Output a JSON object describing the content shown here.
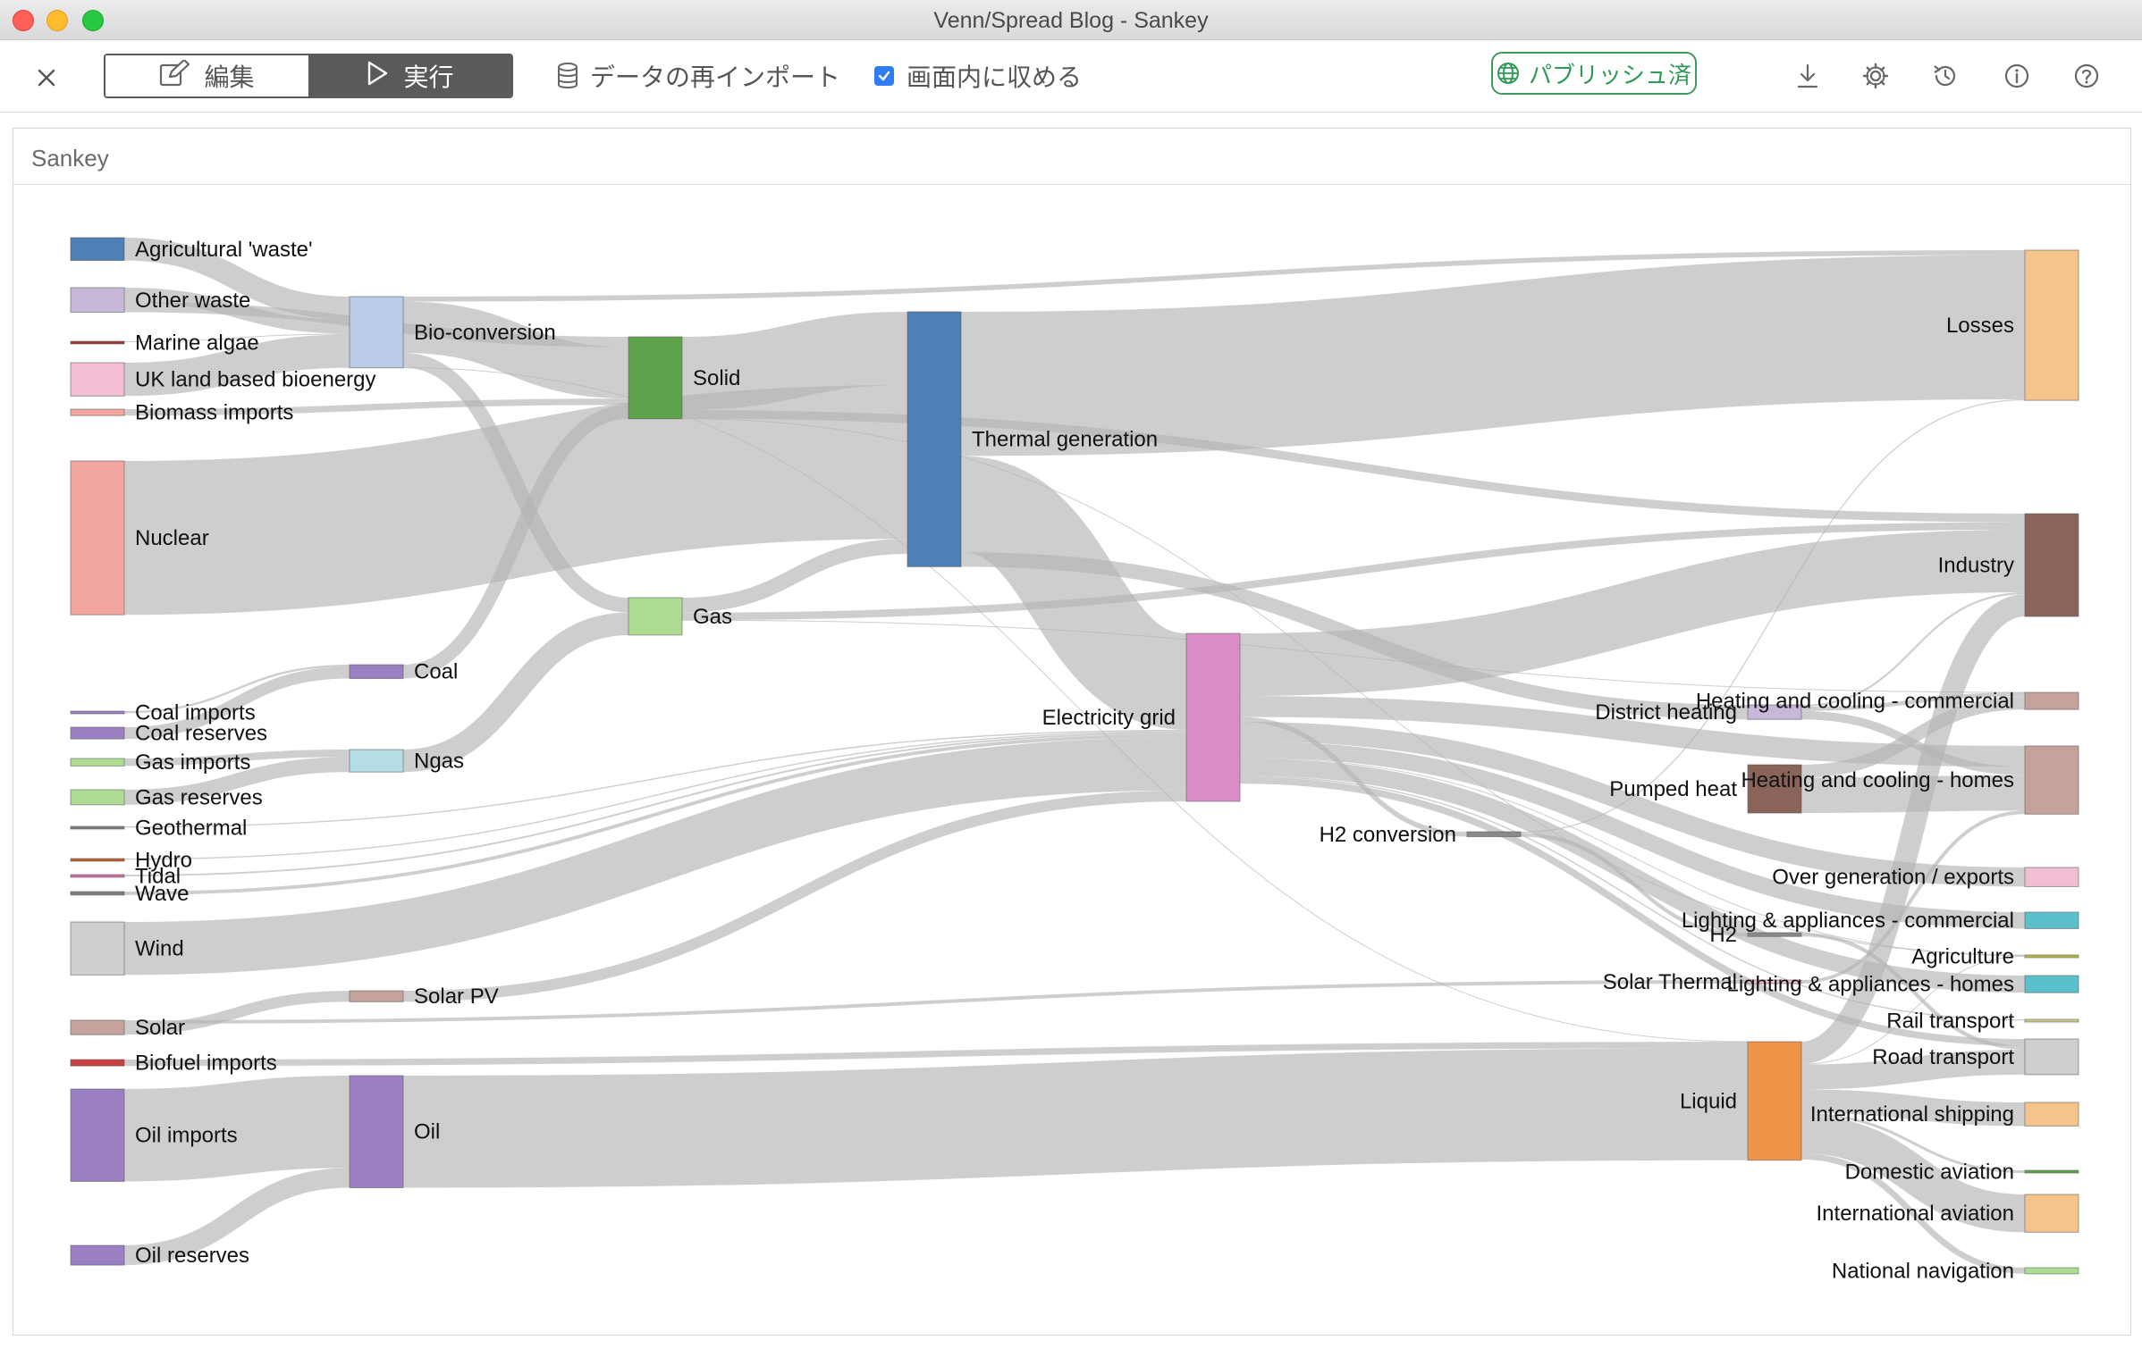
{
  "window": {
    "title": "Venn/Spread Blog - Sankey",
    "controls": [
      "close",
      "minimize",
      "zoom"
    ]
  },
  "toolbar": {
    "close_icon": "close-icon",
    "edit_label": "編集",
    "run_label": "実行",
    "mode_selected": "実行",
    "reimport_label": "データの再インポート",
    "fit_label": "画面内に収める",
    "fit_checked": true,
    "publish_label": "パブリッシュ済",
    "icons": [
      "download-icon",
      "settings-icon",
      "history-icon",
      "info-icon",
      "help-icon"
    ]
  },
  "panel": {
    "title": "Sankey"
  },
  "colors": {
    "accent_dark": "#5a5a5a",
    "checkbox": "#2f7cf6",
    "publish_green": "#2f9a55",
    "link": "#b4b4b4"
  },
  "chart_data": {
    "type": "sankey",
    "nodes": [
      {
        "id": "agri",
        "label": "Agricultural 'waste'",
        "color": "#4e7fb5"
      },
      {
        "id": "otherwaste",
        "label": "Other waste",
        "color": "#c7b8d9"
      },
      {
        "id": "marine",
        "label": "Marine algae",
        "color": "#9c3a3a"
      },
      {
        "id": "ukland",
        "label": "UK land based bioenergy",
        "color": "#f1bed3"
      },
      {
        "id": "biomassimp",
        "label": "Biomass imports",
        "color": "#f2a6a0"
      },
      {
        "id": "nuclear",
        "label": "Nuclear",
        "color": "#f2a6a0"
      },
      {
        "id": "coalimp",
        "label": "Coal imports",
        "color": "#9b7fc3"
      },
      {
        "id": "coalres",
        "label": "Coal reserves",
        "color": "#9b7fc3"
      },
      {
        "id": "gasimp",
        "label": "Gas imports",
        "color": "#addc92"
      },
      {
        "id": "gasres",
        "label": "Gas reserves",
        "color": "#addc92"
      },
      {
        "id": "geothermal",
        "label": "Geothermal",
        "color": "#7f7f7f"
      },
      {
        "id": "hydro",
        "label": "Hydro",
        "color": "#c05c2a"
      },
      {
        "id": "tidal",
        "label": "Tidal",
        "color": "#d16ea6"
      },
      {
        "id": "wave",
        "label": "Wave",
        "color": "#7f7f7f"
      },
      {
        "id": "wind",
        "label": "Wind",
        "color": "#cfcfcf"
      },
      {
        "id": "solar",
        "label": "Solar",
        "color": "#c5a39c"
      },
      {
        "id": "biofuelimp",
        "label": "Biofuel imports",
        "color": "#c94040"
      },
      {
        "id": "oilimp",
        "label": "Oil imports",
        "color": "#9b7fc3"
      },
      {
        "id": "oilres",
        "label": "Oil reserves",
        "color": "#9b7fc3"
      },
      {
        "id": "bioconv",
        "label": "Bio-conversion",
        "color": "#b9cce8"
      },
      {
        "id": "coal",
        "label": "Coal",
        "color": "#9b7fc3"
      },
      {
        "id": "ngas",
        "label": "Ngas",
        "color": "#b5dde7"
      },
      {
        "id": "solarpv",
        "label": "Solar PV",
        "color": "#c5a39c"
      },
      {
        "id": "oil",
        "label": "Oil",
        "color": "#9b7fc3"
      },
      {
        "id": "solid",
        "label": "Solid",
        "color": "#5ea34b"
      },
      {
        "id": "gas",
        "label": "Gas",
        "color": "#addc92"
      },
      {
        "id": "thermal",
        "label": "Thermal generation",
        "color": "#4e7fb5"
      },
      {
        "id": "grid",
        "label": "Electricity grid",
        "color": "#d98cc6"
      },
      {
        "id": "h2conv",
        "label": "H2 conversion",
        "color": "#8a8a8a"
      },
      {
        "id": "districtheat",
        "label": "District heating",
        "color": "#c7b8d9"
      },
      {
        "id": "pumpedheat",
        "label": "Pumped heat",
        "color": "#8b6459"
      },
      {
        "id": "h2",
        "label": "H2",
        "color": "#8a8a8a"
      },
      {
        "id": "solarthermal",
        "label": "Solar Thermal",
        "color": "#f1bed3"
      },
      {
        "id": "liquid",
        "label": "Liquid",
        "color": "#f0944a"
      },
      {
        "id": "losses",
        "label": "Losses",
        "color": "#f5c48c"
      },
      {
        "id": "industry",
        "label": "Industry",
        "color": "#8b6459"
      },
      {
        "id": "hccomm",
        "label": "Heating and cooling - commercial",
        "color": "#c5a39c"
      },
      {
        "id": "hchomes",
        "label": "Heating and cooling - homes",
        "color": "#c5a39c"
      },
      {
        "id": "overgen",
        "label": "Over generation / exports",
        "color": "#f1bed3"
      },
      {
        "id": "lacomm",
        "label": "Lighting & appliances - commercial",
        "color": "#5bbfcc"
      },
      {
        "id": "agriculture",
        "label": "Agriculture",
        "color": "#b8b845"
      },
      {
        "id": "lahomes",
        "label": "Lighting & appliances - homes",
        "color": "#5bbfcc"
      },
      {
        "id": "rail",
        "label": "Rail transport",
        "color": "#c9c98a"
      },
      {
        "id": "road",
        "label": "Road transport",
        "color": "#cfcfcf"
      },
      {
        "id": "intship",
        "label": "International shipping",
        "color": "#f5c48c"
      },
      {
        "id": "domav",
        "label": "Domestic aviation",
        "color": "#5ea34b"
      },
      {
        "id": "intav",
        "label": "International aviation",
        "color": "#f5c48c"
      },
      {
        "id": "natnav",
        "label": "National navigation",
        "color": "#addc92"
      }
    ],
    "links": [
      {
        "source": "agri",
        "target": "bioconv",
        "value": 124.7
      },
      {
        "source": "bioconv",
        "target": "liquid",
        "value": 0.6
      },
      {
        "source": "bioconv",
        "target": "losses",
        "value": 26.9
      },
      {
        "source": "bioconv",
        "target": "solid",
        "value": 280.3
      },
      {
        "source": "bioconv",
        "target": "gas",
        "value": 81.1
      },
      {
        "source": "biofuelimp",
        "target": "liquid",
        "value": 35
      },
      {
        "source": "biomassimp",
        "target": "solid",
        "value": 35
      },
      {
        "source": "coalimp",
        "target": "coal",
        "value": 11.6
      },
      {
        "source": "coalres",
        "target": "coal",
        "value": 63.9
      },
      {
        "source": "coal",
        "target": "solid",
        "value": 75.6
      },
      {
        "source": "districtheat",
        "target": "industry",
        "value": 10.6
      },
      {
        "source": "districtheat",
        "target": "hccomm",
        "value": 22.5
      },
      {
        "source": "districtheat",
        "target": "hchomes",
        "value": 46.2
      },
      {
        "source": "grid",
        "target": "overgen",
        "value": 104.5
      },
      {
        "source": "grid",
        "target": "hchomes",
        "value": 113.7
      },
      {
        "source": "grid",
        "target": "h2conv",
        "value": 27.1
      },
      {
        "source": "grid",
        "target": "industry",
        "value": 342.2
      },
      {
        "source": "grid",
        "target": "road",
        "value": 37.8
      },
      {
        "source": "grid",
        "target": "agriculture",
        "value": 4.4
      },
      {
        "source": "grid",
        "target": "rail",
        "value": 7.0
      },
      {
        "source": "grid",
        "target": "lacomm",
        "value": 90.0
      },
      {
        "source": "grid",
        "target": "lahomes",
        "value": 93.5
      },
      {
        "source": "gasimp",
        "target": "ngas",
        "value": 40.7
      },
      {
        "source": "gasres",
        "target": "ngas",
        "value": 82.2
      },
      {
        "source": "gas",
        "target": "hccomm",
        "value": 0.1
      },
      {
        "source": "gas",
        "target": "industry",
        "value": 40.7
      },
      {
        "source": "gas",
        "target": "thermal",
        "value": 82.2
      },
      {
        "source": "geothermal",
        "target": "grid",
        "value": 7.0
      },
      {
        "source": "h2conv",
        "target": "h2",
        "value": 20.9
      },
      {
        "source": "h2conv",
        "target": "losses",
        "value": 6.2
      },
      {
        "source": "h2",
        "target": "road",
        "value": 20.9
      },
      {
        "source": "hydro",
        "target": "grid",
        "value": 6.9
      },
      {
        "source": "liquid",
        "target": "industry",
        "value": 121.1
      },
      {
        "source": "liquid",
        "target": "intship",
        "value": 128.7
      },
      {
        "source": "liquid",
        "target": "road",
        "value": 135.8
      },
      {
        "source": "liquid",
        "target": "domav",
        "value": 14.5
      },
      {
        "source": "liquid",
        "target": "intav",
        "value": 206.3
      },
      {
        "source": "liquid",
        "target": "agriculture",
        "value": 3.6
      },
      {
        "source": "liquid",
        "target": "natnav",
        "value": 33.2
      },
      {
        "source": "marine",
        "target": "bioconv",
        "value": 4.4
      },
      {
        "source": "ngas",
        "target": "gas",
        "value": 122.9
      },
      {
        "source": "nuclear",
        "target": "thermal",
        "value": 839.9
      },
      {
        "source": "oilimp",
        "target": "oil",
        "value": 504.3
      },
      {
        "source": "oilres",
        "target": "oil",
        "value": 107.7
      },
      {
        "source": "oil",
        "target": "liquid",
        "value": 611.9
      },
      {
        "source": "otherwaste",
        "target": "solid",
        "value": 56.6
      },
      {
        "source": "otherwaste",
        "target": "bioconv",
        "value": 77.8
      },
      {
        "source": "pumpedheat",
        "target": "hchomes",
        "value": 193.0
      },
      {
        "source": "pumpedheat",
        "target": "hccomm",
        "value": 70.7
      },
      {
        "source": "solarpv",
        "target": "grid",
        "value": 59.9
      },
      {
        "source": "solarthermal",
        "target": "hchomes",
        "value": 19.3
      },
      {
        "source": "solar",
        "target": "solarthermal",
        "value": 19.3
      },
      {
        "source": "solar",
        "target": "solarpv",
        "value": 59.9
      },
      {
        "source": "solid",
        "target": "agriculture",
        "value": 0.9
      },
      {
        "source": "solid",
        "target": "thermal",
        "value": 400.1
      },
      {
        "source": "solid",
        "target": "industry",
        "value": 46.5
      },
      {
        "source": "thermal",
        "target": "grid",
        "value": 525.5
      },
      {
        "source": "thermal",
        "target": "losses",
        "value": 787.1
      },
      {
        "source": "thermal",
        "target": "districtheat",
        "value": 79.3
      },
      {
        "source": "tidal",
        "target": "grid",
        "value": 9.5
      },
      {
        "source": "ukland",
        "target": "bioconv",
        "value": 182.0
      },
      {
        "source": "wave",
        "target": "grid",
        "value": 19.0
      },
      {
        "source": "wind",
        "target": "grid",
        "value": 289.4
      }
    ]
  }
}
